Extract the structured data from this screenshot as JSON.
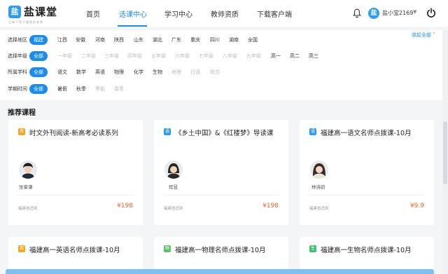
{
  "header": {
    "logo_mark": "盐",
    "logo_title": "盐课堂",
    "logo_slogan": "让每个孩子遇到好老师",
    "nav": [
      {
        "label": "首页",
        "active": false
      },
      {
        "label": "选课中心",
        "active": true
      },
      {
        "label": "学习中心",
        "active": false
      },
      {
        "label": "教师资质",
        "active": false
      },
      {
        "label": "下载客户端",
        "active": false
      }
    ],
    "avatar_letter": "盐",
    "username": "盐小宝2169",
    "accent": "#1a8cf0"
  },
  "filters": {
    "collapse_label": "收起全部",
    "rows": [
      {
        "label": "选择地区",
        "options": [
          {
            "text": "福建",
            "state": "active"
          },
          {
            "text": "江西",
            "state": "normal"
          },
          {
            "text": "安徽",
            "state": "normal"
          },
          {
            "text": "河南",
            "state": "normal"
          },
          {
            "text": "陕西",
            "state": "normal"
          },
          {
            "text": "山东",
            "state": "normal"
          },
          {
            "text": "湖北",
            "state": "normal"
          },
          {
            "text": "广东",
            "state": "normal"
          },
          {
            "text": "重庆",
            "state": "normal"
          },
          {
            "text": "四川",
            "state": "normal"
          },
          {
            "text": "湖南",
            "state": "normal"
          },
          {
            "text": "全国",
            "state": "normal"
          }
        ]
      },
      {
        "label": "选择年级",
        "options": [
          {
            "text": "全部",
            "state": "active"
          },
          {
            "text": "一年级",
            "state": "disabled"
          },
          {
            "text": "二年级",
            "state": "disabled"
          },
          {
            "text": "三年级",
            "state": "disabled"
          },
          {
            "text": "四年级",
            "state": "disabled"
          },
          {
            "text": "五年级",
            "state": "disabled"
          },
          {
            "text": "六年级",
            "state": "disabled"
          },
          {
            "text": "七年级",
            "state": "disabled"
          },
          {
            "text": "八年级",
            "state": "disabled"
          },
          {
            "text": "九年级",
            "state": "disabled"
          },
          {
            "text": "高一",
            "state": "normal"
          },
          {
            "text": "高二",
            "state": "normal"
          },
          {
            "text": "高三",
            "state": "normal"
          }
        ]
      },
      {
        "label": "所属学科",
        "options": [
          {
            "text": "全部",
            "state": "active"
          },
          {
            "text": "语文",
            "state": "normal"
          },
          {
            "text": "数学",
            "state": "normal"
          },
          {
            "text": "英语",
            "state": "normal"
          },
          {
            "text": "物理",
            "state": "normal"
          },
          {
            "text": "化学",
            "state": "normal"
          },
          {
            "text": "生物",
            "state": "normal"
          },
          {
            "text": "地理",
            "state": "disabled"
          },
          {
            "text": "日语",
            "state": "disabled"
          },
          {
            "text": "综合",
            "state": "disabled"
          }
        ]
      },
      {
        "label": "学期时间",
        "options": [
          {
            "text": "全部",
            "state": "active"
          },
          {
            "text": "暑假",
            "state": "normal"
          },
          {
            "text": "秋季",
            "state": "normal"
          },
          {
            "text": "寒假",
            "state": "disabled"
          },
          {
            "text": "春季",
            "state": "disabled"
          }
        ]
      }
    ]
  },
  "section_title": "推荐课程",
  "courses": [
    {
      "subject": "英",
      "subject_color": "#f5a623",
      "title": "时文外刊阅读-新高考必读系列",
      "teacher": "张睿谦",
      "note": "福建省适用",
      "price": "¥198",
      "gender": "m"
    },
    {
      "subject": "语",
      "subject_color": "#2d9cf0",
      "title": "《乡土中国》&《红楼梦》导读课",
      "teacher": "程昱",
      "note": "福建省适用",
      "price": "¥198",
      "gender": "f"
    },
    {
      "subject": "语",
      "subject_color": "#2d9cf0",
      "title": "福建高一语文名师点拨课-10月",
      "teacher": "林诗韵",
      "note": "福建省适用",
      "price": "¥9.9",
      "gender": "f"
    },
    {
      "subject": "英",
      "subject_color": "#f5a623",
      "title": "福建高一英语名师点拨课-10月"
    },
    {
      "subject": "物",
      "subject_color": "#5cc165",
      "title": "福建高一物理名师点拨课-10月"
    },
    {
      "subject": "生",
      "subject_color": "#3dbf6f",
      "title": "福建高一生物名师点拨课-10月"
    }
  ]
}
